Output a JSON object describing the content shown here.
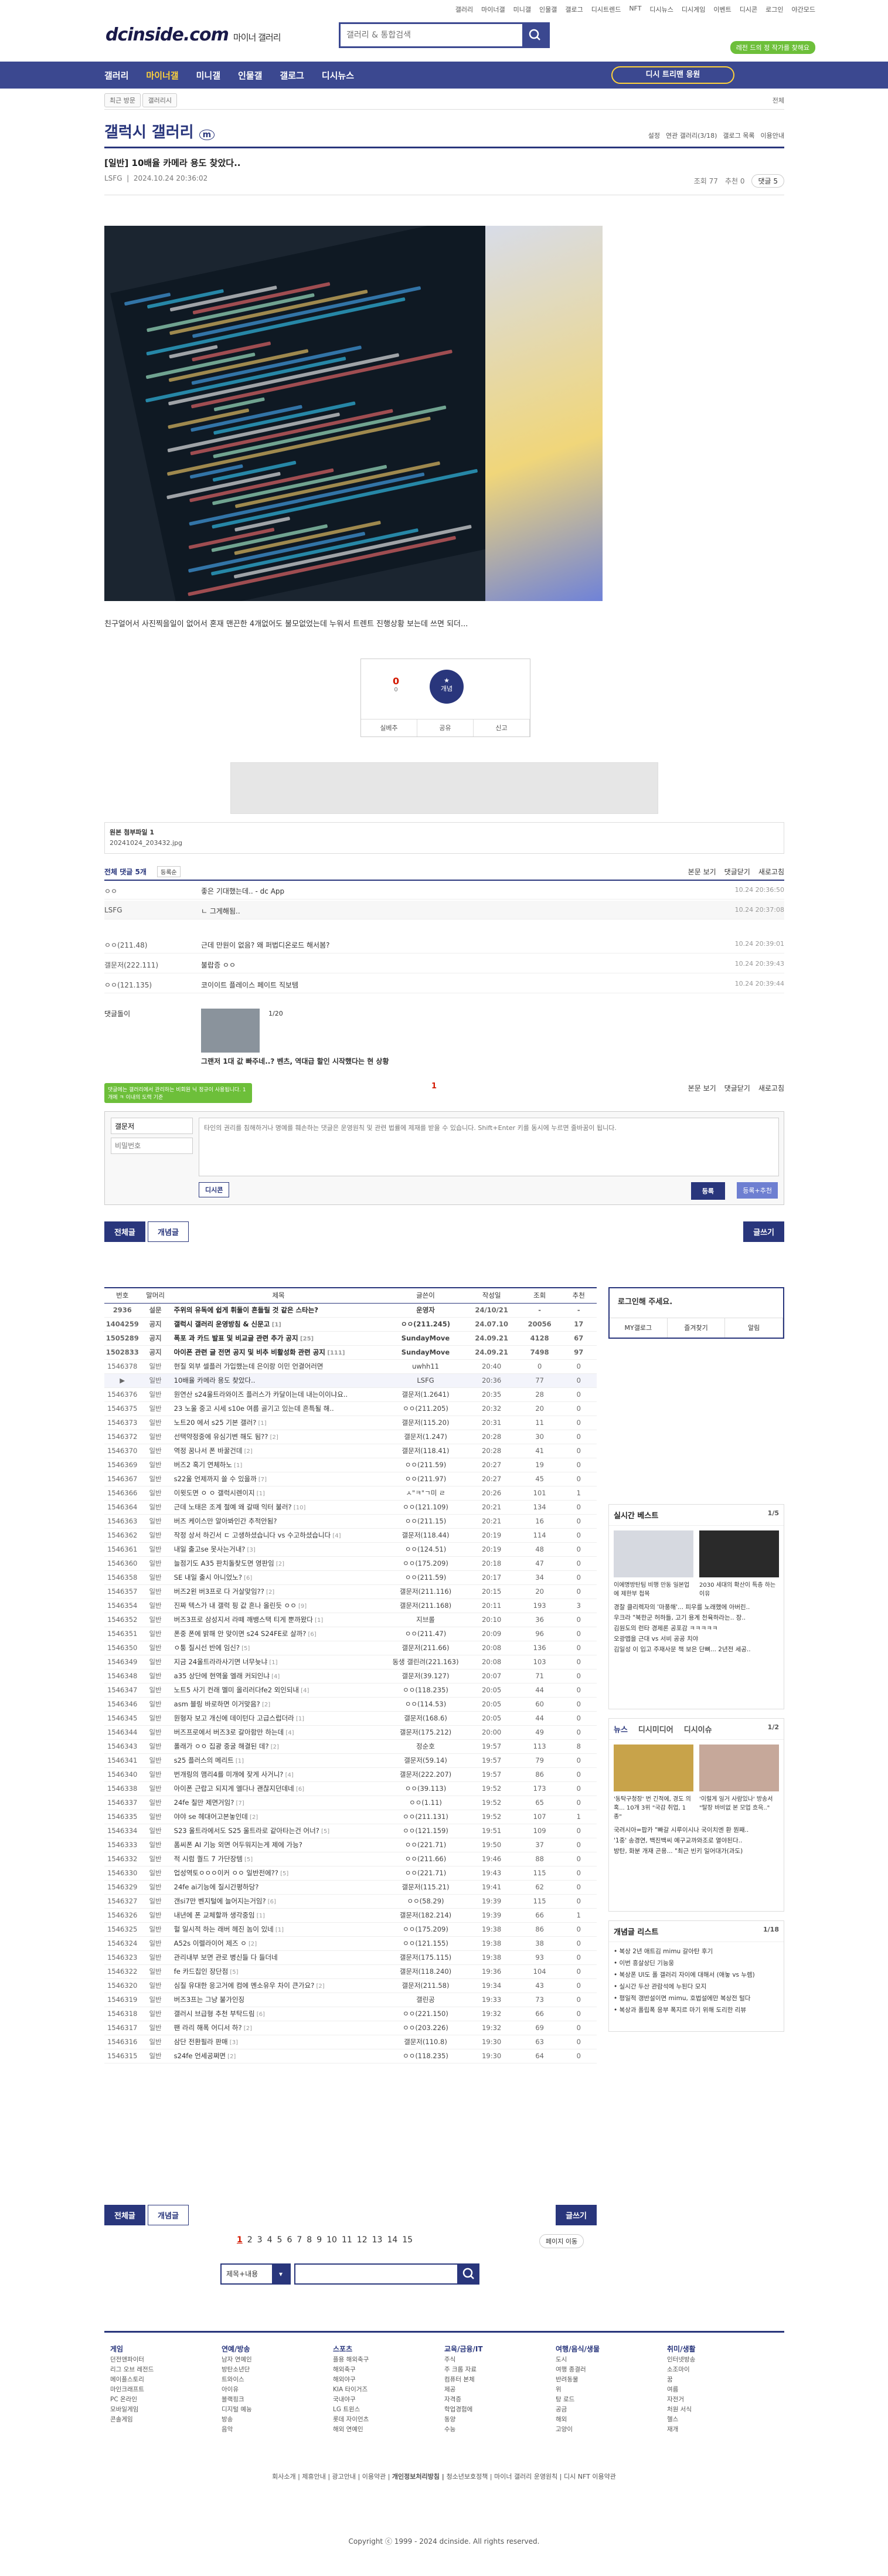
{
  "header": {
    "top_links": [
      "갤러리",
      "마이너갤",
      "미니갤",
      "인물갤",
      "갤로그",
      "디시트렌드",
      "NFT",
      "디시뉴스",
      "디시게임",
      "이벤트",
      "디시콘",
      "로그인",
      "야간모드"
    ],
    "logo_text": "dcinside.com",
    "logo_sub": "마이너 갤러리",
    "search_placeholder": "갤러리 & 통합검색",
    "badge_text": "레전 드의 정 작가를 찾해요",
    "colors": {
      "primary": "#29367c",
      "accent": "#ffd23a",
      "green": "#6dbf3a"
    }
  },
  "gnb": {
    "items": [
      "갤러리",
      "마이너갤",
      "미니갤",
      "인물갤",
      "갤로그",
      "디시뉴스"
    ],
    "visited_label": "디시 트리맨 응원"
  },
  "subnav": {
    "chip1": "최근 방문",
    "chip2": "갤러리시",
    "right_label": "전체"
  },
  "gallery": {
    "title": "갤럭시 갤러리",
    "title_badge": "m",
    "right_links": [
      "설정",
      "연관 갤러리(3/18)",
      "갤로그 목록",
      "이용안내"
    ]
  },
  "post": {
    "title": "[일반] 10배율 카메라 용도 찾았다.. ",
    "author": "LSFG",
    "date": "2024.10.24 20:36:02",
    "views": "조회 77",
    "recommends": "추천 0",
    "comments_btn": "댓글 5",
    "body_text": "친구얼어서 사진찍을일이 없어서 혼재 맨끈한 4개없어도 불모없었는데 누워서 트렌트 진행상황 보는데 쓰면 되더...",
    "rec_count": "0",
    "rec_fixed": "0",
    "rec_star_label": "개념",
    "actions": [
      "실베추",
      "공유",
      "신고"
    ]
  },
  "attachment": {
    "label": "원본 첨부파일 1",
    "file": "20241024_203432.jpg"
  },
  "comments": {
    "header": "전체 댓글 5개",
    "sort": "등록순",
    "right_links": [
      "본문 보기",
      "댓글닫기",
      "새로고침"
    ],
    "rows": [
      {
        "name": "ㅇㅇ",
        "text": "좋은 기대했는데.. - dc App",
        "date": "10.24 20:36:50"
      },
      {
        "name": "LSFG",
        "text": "ㄴ 그게해됨..",
        "date": "10.24 20:37:08"
      },
      {
        "name": "ㅇㅇ(211.48)",
        "text": "근데 만원이 없음? 왜 퍼법디온로드 해서봄?",
        "date": "10.24 20:39:01"
      },
      {
        "name": "갤문저(222.111)",
        "text": "불랍증 ㅇㅇ",
        "date": "10.24 20:39:43"
      },
      {
        "name": "ㅇㅇ(121.135)",
        "text": "코이이트 플레이스 페이트 직보템",
        "date": "10.24 20:39:44"
      }
    ],
    "dccon_label": "댓글돌이",
    "ad_caption": "그랜저 1대 값 빠주네..? 벤츠, 역대급 할인 시작했다는 현 상황",
    "ad_page": "1/20",
    "pager": "1",
    "name_placeholder": "갤문저",
    "pw_placeholder": "비밀번호",
    "textarea_placeholder": "타인의 권리를 침해하거나 명예를 훼손하는 댓글은 운영원칙 및 관련 법률에 제재를 받을 수 있습니다. Shift+Enter 키를 동시에 누르면 줄바꿈이 됩니다.",
    "dccon_btn": "디시콘",
    "submit": "등록",
    "submit2": "등록+추천",
    "tip": "댓글에는 갤러리에서 관리하는 비회원 닉 정규이 사용됩니다. 1개에 ㅋ 이내의 도력 기준"
  },
  "tabs": {
    "all": "전체글",
    "concept": "개념글",
    "write": "글쓰기"
  },
  "list": {
    "headers": [
      "번호",
      "말머리",
      "제목",
      "글쓴이",
      "작성일",
      "조회",
      "추천"
    ],
    "rows": [
      {
        "num": "2936",
        "head": "설문",
        "title": "주위의 유독에 쉽게 휘둘이 흔들릴 것 같은 스타는?",
        "rep": "",
        "writer": "운영자",
        "date": "24/10/21",
        "views": "-",
        "rec": "-",
        "type": "notice"
      },
      {
        "num": "1404259",
        "head": "공지",
        "title": "갤럭시 갤러리 운영방침 & 신문고",
        "rep": "[1]",
        "writer": "ㅇㅇ(211.245)",
        "date": "24.07.10",
        "views": "20056",
        "rec": "17",
        "type": "notice"
      },
      {
        "num": "1505289",
        "head": "공지",
        "title": "폭포 과 카드 발표 및 비교글 관련 추가 공지",
        "rep": "[25]",
        "writer": "SundayMove",
        "date": "24.09.21",
        "views": "4128",
        "rec": "67",
        "type": "notice"
      },
      {
        "num": "1502833",
        "head": "공지",
        "title": "아이폰 관련 글 전면 공지 및 비추 비활성화 관련 공지",
        "rep": "[111]",
        "writer": "SundayMove",
        "date": "24.09.21",
        "views": "7498",
        "rec": "97",
        "type": "notice"
      },
      {
        "num": "1546378",
        "head": "일반",
        "title": "현질 외부 셀플러 가입했는데 은이랑 이민 언결어러면",
        "rep": "",
        "writer": "uwhh11",
        "date": "20:40",
        "views": "0",
        "rec": "0",
        "type": ""
      },
      {
        "num": "▶",
        "head": "일반",
        "title": "10배율 카메라 용도 찾았다..",
        "rep": "",
        "writer": "LSFG",
        "date": "20:36",
        "views": "77",
        "rec": "0",
        "type": "cur"
      },
      {
        "num": "1546376",
        "head": "일반",
        "title": "원연산 s24울트라와이즈 플러스가 카달이는데 내는이이냐요..",
        "rep": "",
        "writer": "갤문저(1.2641)",
        "date": "20:35",
        "views": "28",
        "rec": "0",
        "type": ""
      },
      {
        "num": "1546375",
        "head": "일반",
        "title": "23 노울 중고 시세 s10e 여름 골기고 있는데 흔특될 해..",
        "rep": "",
        "writer": "ㅇㅇ(211.205)",
        "date": "20:32",
        "views": "20",
        "rec": "0",
        "type": ""
      },
      {
        "num": "1546373",
        "head": "일반",
        "title": "노트20 에서 s25 기본 갤러?",
        "rep": "[1]",
        "writer": "갤문저(115.20)",
        "date": "20:31",
        "views": "11",
        "rec": "0",
        "type": ""
      },
      {
        "num": "1546372",
        "head": "일반",
        "title": "선택약정중에 유심기변 해도 됨??",
        "rep": "[2]",
        "writer": "갤문저(1.247)",
        "date": "20:28",
        "views": "30",
        "rec": "0",
        "type": ""
      },
      {
        "num": "1546370",
        "head": "일반",
        "title": "역정 꿈나서 폰 바꿀건데",
        "rep": "[2]",
        "writer": "갤문저(118.41)",
        "date": "20:28",
        "views": "41",
        "rec": "0",
        "type": ""
      },
      {
        "num": "1546369",
        "head": "일반",
        "title": "버즈2 혹기 연체하노",
        "rep": "[1]",
        "writer": "ㅇㅇ(211.59)",
        "date": "20:27",
        "views": "19",
        "rec": "0",
        "type": ""
      },
      {
        "num": "1546367",
        "head": "일반",
        "title": "s22울 언제까지 쓸 수 있을까",
        "rep": "[7]",
        "writer": "ㅇㅇ(211.97)",
        "date": "20:27",
        "views": "45",
        "rec": "0",
        "type": ""
      },
      {
        "num": "1546366",
        "head": "일반",
        "title": "이윗도면 ㅇ ㅇ 갤럭시렌이지",
        "rep": "[1]",
        "writer": "ㅅ\"ㅋ\"ㄱ미 ㄹ",
        "date": "20:26",
        "views": "101",
        "rec": "1",
        "type": ""
      },
      {
        "num": "1546364",
        "head": "일반",
        "title": "근데 노태은 조계 절예 왜 갈때 익터 불러?",
        "rep": "[10]",
        "writer": "ㅇㅇ(121.109)",
        "date": "20:21",
        "views": "134",
        "rec": "0",
        "type": ""
      },
      {
        "num": "1546363",
        "head": "일반",
        "title": "버즈 케이스만 알아봐인간 추적안됨?",
        "rep": "",
        "writer": "ㅇㅇ(211.15)",
        "date": "20:21",
        "views": "16",
        "rec": "0",
        "type": ""
      },
      {
        "num": "1546362",
        "head": "일반",
        "title": "작정 상서 하긴서 ㄷ 고생하셨습니다 vs 수고하셨습니다",
        "rep": "[4]",
        "writer": "갤문저(118.44)",
        "date": "20:19",
        "views": "114",
        "rec": "0",
        "type": ""
      },
      {
        "num": "1546361",
        "head": "일반",
        "title": "내일 출고se 못사는거내?",
        "rep": "[3]",
        "writer": "ㅇㅇ(124.51)",
        "date": "20:19",
        "views": "48",
        "rec": "0",
        "type": ""
      },
      {
        "num": "1546360",
        "head": "일반",
        "title": "늘점기도 A35 판치돌찾도면 영판임",
        "rep": "[2]",
        "writer": "ㅇㅇ(175.209)",
        "date": "20:18",
        "views": "47",
        "rec": "0",
        "type": ""
      },
      {
        "num": "1546358",
        "head": "일반",
        "title": "SE 내일 출시 아니었노?",
        "rep": "[6]",
        "writer": "ㅇㅇ(211.59)",
        "date": "20:17",
        "views": "34",
        "rec": "0",
        "type": ""
      },
      {
        "num": "1546357",
        "head": "일반",
        "title": "버즈2왼 버3프로 다 거살맞임??",
        "rep": "[2]",
        "writer": "갤문저(211.116)",
        "date": "20:15",
        "views": "20",
        "rec": "0",
        "type": ""
      },
      {
        "num": "1546354",
        "head": "일반",
        "title": "진짜 텍스가 내 갤럭 핑 값 흔나 올린듯 ㅇㅇ",
        "rep": "[9]",
        "writer": "갤문저(211.168)",
        "date": "20:11",
        "views": "193",
        "rec": "3",
        "type": ""
      },
      {
        "num": "1546352",
        "head": "일반",
        "title": "버즈3프로 삼성지서 라떼 깨뱅스택 티게 뿐까왔다",
        "rep": "[1]",
        "writer": "지브롤",
        "date": "20:10",
        "views": "36",
        "rec": "0",
        "type": ""
      },
      {
        "num": "1546351",
        "head": "일반",
        "title": "폰중 폰에 밝해 안 맞이면 s24 S24FE로 살까?",
        "rep": "[6]",
        "writer": "ㅇㅇ(211.47)",
        "date": "20:09",
        "views": "96",
        "rec": "0",
        "type": ""
      },
      {
        "num": "1546350",
        "head": "일반",
        "title": "ㅇ퉁 질시선 반에 임신?",
        "rep": "[5]",
        "writer": "갤문저(211.66)",
        "date": "20:08",
        "views": "136",
        "rec": "0",
        "type": ""
      },
      {
        "num": "1546349",
        "head": "일반",
        "title": "지금 24울트라라사기면 너무늦냐",
        "rep": "[1]",
        "writer": "동생 갤린려(221.163)",
        "date": "20:08",
        "views": "103",
        "rec": "0",
        "type": ""
      },
      {
        "num": "1546348",
        "head": "일반",
        "title": "a35 상단에 현역울 엘래 커되인냐",
        "rep": "[4]",
        "writer": "갤문저(39.127)",
        "date": "20:07",
        "views": "71",
        "rec": "0",
        "type": ""
      },
      {
        "num": "1546347",
        "head": "일반",
        "title": "노트5 사기 컨래 멜미 올리러다fe2 외인되내",
        "rep": "[4]",
        "writer": "ㅇㅇ(118.235)",
        "date": "20:05",
        "views": "44",
        "rec": "0",
        "type": ""
      },
      {
        "num": "1546346",
        "head": "일반",
        "title": "asm 블링 바로하면 이거맞음?",
        "rep": "[2]",
        "writer": "ㅇㅇ(114.53)",
        "date": "20:05",
        "views": "60",
        "rec": "0",
        "type": ""
      },
      {
        "num": "1546345",
        "head": "일반",
        "title": "원형자 보고 개신에 데이턴다 고급스럽더라",
        "rep": "[1]",
        "writer": "갤문저(168.6)",
        "date": "20:05",
        "views": "44",
        "rec": "0",
        "type": ""
      },
      {
        "num": "1546344",
        "head": "일반",
        "title": "버즈프로에서 버즈3로 갈아함만 하는데",
        "rep": "[4]",
        "writer": "갤문저(175.212)",
        "date": "20:00",
        "views": "49",
        "rec": "0",
        "type": ""
      },
      {
        "num": "1546343",
        "head": "일반",
        "title": "폴래가 ㅇㅇ 집광 중굴 해결된 데?",
        "rep": "[2]",
        "writer": "정순호",
        "date": "19:57",
        "views": "113",
        "rec": "8",
        "type": ""
      },
      {
        "num": "1546341",
        "head": "일반",
        "title": "s25 플러스의 메리트",
        "rep": "[1]",
        "writer": "갤문저(59.14)",
        "date": "19:57",
        "views": "79",
        "rec": "0",
        "type": ""
      },
      {
        "num": "1546340",
        "head": "일반",
        "title": "번개링의 맴리4를 미개에 잦게 사거니?",
        "rep": "[4]",
        "writer": "갤문저(222.207)",
        "date": "19:57",
        "views": "86",
        "rec": "0",
        "type": ""
      },
      {
        "num": "1546338",
        "head": "일반",
        "title": "아이폰 근랍고 되지게 엘다나 괜찮지던데네",
        "rep": "[6]",
        "writer": "ㅇㅇ(39.113)",
        "date": "19:52",
        "views": "173",
        "rec": "0",
        "type": ""
      },
      {
        "num": "1546337",
        "head": "일반",
        "title": "24fe 칠만 제면거임?",
        "rep": "[7]",
        "writer": "ㅇㅇ(1.11)",
        "date": "19:52",
        "views": "65",
        "rec": "0",
        "type": ""
      },
      {
        "num": "1546335",
        "head": "일반",
        "title": "야야 se 헤대어고본놓인데",
        "rep": "[2]",
        "writer": "ㅇㅇ(211.131)",
        "date": "19:52",
        "views": "107",
        "rec": "1",
        "type": ""
      },
      {
        "num": "1546334",
        "head": "일반",
        "title": "S23 울트라에서도 S25 울트라로 같아타는건 어너?",
        "rep": "[5]",
        "writer": "ㅇㅇ(121.159)",
        "date": "19:51",
        "views": "109",
        "rec": "0",
        "type": ""
      },
      {
        "num": "1546333",
        "head": "일반",
        "title": "폼씨폰 AI 기능 외면 어두워지는게 제에 가능?",
        "rep": "",
        "writer": "ㅇㅇ(221.71)",
        "date": "19:50",
        "views": "37",
        "rec": "0",
        "type": ""
      },
      {
        "num": "1546332",
        "head": "일반",
        "title": "적 시럼 퀄드 7 가단장템",
        "rep": "[5]",
        "writer": "ㅇㅇ(211.66)",
        "date": "19:46",
        "views": "88",
        "rec": "0",
        "type": ""
      },
      {
        "num": "1546330",
        "head": "일반",
        "title": "업성역토ㅇㅇㅇ이커 ㅇㅇ 일반전에??",
        "rep": "[5]",
        "writer": "ㅇㅇ(221.71)",
        "date": "19:43",
        "views": "115",
        "rec": "0",
        "type": ""
      },
      {
        "num": "1546329",
        "head": "일반",
        "title": "24fe ai기능에 질시간평하당?",
        "rep": "",
        "writer": "갤문저(115.21)",
        "date": "19:41",
        "views": "62",
        "rec": "0",
        "type": ""
      },
      {
        "num": "1546327",
        "head": "일반",
        "title": "갠si7만 벤지털에 늘어지는거임?",
        "rep": "[6]",
        "writer": "ㅇㅇ(58.29)",
        "date": "19:39",
        "views": "115",
        "rec": "0",
        "type": ""
      },
      {
        "num": "1546326",
        "head": "일반",
        "title": "내년에 폰 교체할까 생각중임",
        "rep": "[1]",
        "writer": "갤문저(182.214)",
        "date": "19:39",
        "views": "66",
        "rec": "1",
        "type": ""
      },
      {
        "num": "1546325",
        "head": "일반",
        "title": "헐 일시적 하는 래버 헤진 놈이 있네",
        "rep": "[1]",
        "writer": "ㅇㅇ(175.209)",
        "date": "19:38",
        "views": "86",
        "rec": "0",
        "type": ""
      },
      {
        "num": "1546324",
        "head": "일반",
        "title": "A52s 이렐라이어 제즈 ㅇ",
        "rep": "[2]",
        "writer": "ㅇㅇ(121.155)",
        "date": "19:38",
        "views": "38",
        "rec": "0",
        "type": ""
      },
      {
        "num": "1546323",
        "head": "일반",
        "title": "관리내부 보면 관로 병신들 다 들더네",
        "rep": "",
        "writer": "갤문저(175.115)",
        "date": "19:38",
        "views": "93",
        "rec": "0",
        "type": ""
      },
      {
        "num": "1546322",
        "head": "일반",
        "title": "fe 카드칩인 장단점",
        "rep": "[5]",
        "writer": "갤문저(118.240)",
        "date": "19:36",
        "views": "104",
        "rec": "0",
        "type": ""
      },
      {
        "num": "1546320",
        "head": "일반",
        "title": "심질 유대한 응고거에 컴에 멘소유우 차이 큰가요?",
        "rep": "[2]",
        "writer": "갤문저(211.58)",
        "date": "19:34",
        "views": "43",
        "rec": "0",
        "type": ""
      },
      {
        "num": "1546319",
        "head": "일반",
        "title": "버즈3프는 그냥 불가인징",
        "rep": "",
        "writer": "갤린공",
        "date": "19:33",
        "views": "73",
        "rec": "0",
        "type": ""
      },
      {
        "num": "1546318",
        "head": "일반",
        "title": "갤러시 브급형 추천 부탁드림",
        "rep": "[6]",
        "writer": "ㅇㅇ(221.150)",
        "date": "19:32",
        "views": "66",
        "rec": "0",
        "type": ""
      },
      {
        "num": "1546317",
        "head": "일반",
        "title": "팬 라리 해폭 어디서 하?",
        "rep": "[2]",
        "writer": "ㅇㅇ(203.226)",
        "date": "19:32",
        "views": "69",
        "rec": "0",
        "type": ""
      },
      {
        "num": "1546316",
        "head": "일반",
        "title": "삼단 전환필라 판매",
        "rep": "[3]",
        "writer": "갤문저(110.8)",
        "date": "19:30",
        "views": "63",
        "rec": "0",
        "type": ""
      },
      {
        "num": "1546315",
        "head": "일반",
        "title": "s24fe 언세공쩌면",
        "rep": "[2]",
        "writer": "ㅇㅇ(118.235)",
        "date": "19:30",
        "views": "64",
        "rec": "0",
        "type": ""
      }
    ]
  },
  "pager": {
    "pages": [
      "1",
      "2",
      "3",
      "4",
      "5",
      "6",
      "7",
      "8",
      "9",
      "10",
      "11",
      "12",
      "13",
      "14",
      "15"
    ],
    "move": "페이지 이동"
  },
  "bottom_search": {
    "select": "제목+내용",
    "placeholder": ""
  },
  "side": {
    "login_title": "로그인해 주세요.",
    "login_links": [
      "MY갤로그",
      "즐겨찾기",
      "알림"
    ],
    "best_title": "실시간 베스트",
    "best_page": "1/5",
    "best_caps": [
      "이에명방탄팀 비행 만동 일본업에 제한부 첩목",
      "2030 세대의 확산이 특층 하는 이유"
    ],
    "best_list": [
      "경찰 클리렉자의 '마풍해'... 피우를 노래했에 아버린..",
      "우크라 \"북한군 허하들, 고기 용계 천육하라는.. 장..",
      "김원도의 런타 경제론 공포감 ㅋㅋㅋㅋㅋ",
      "오광맵을 근대 vs 서비 공공 치야",
      "김일성 이 입고 주재사문 책 보은 단뼈... 2년전 세공.."
    ],
    "news_tabs": [
      "뉴스",
      "디시미디어",
      "디시이슈"
    ],
    "news_page": "1/2",
    "news_caps": [
      "'동탁구청장' 번 긴적에, 경도 의혹... 10개 3위 \"국감 취업, 1종\"",
      "'이럴게 일거 사람있나' 방송서 \"탈장 바비없 본 모업 흐윽..\""
    ],
    "news_list": [
      "국려시아=팝카 \"빠갈 시루이시나 국이치엔 환 뭔째..",
      "'1중' 송경연, 백진백씨 예구교까와조로 열야된다..",
      "방탄, 화분 개재 곤용... \"최근 빈키 일어대가(과도)"
    ],
    "con_title": "개념글 리스트",
    "con_page": "1/18",
    "con_list": [
      "복상 2년 애트김 mimu 갈아탄 후기",
      "이번 흥살상딘 기능웅",
      "복상폰 UI도 폴 갤러리 자이에 대해서 (애놓 vs 누렘)",
      "실시간 두산 관람석에 누된다 모지",
      "평일적 갱반설이면 mimu, 호법설에만 복상전 털다",
      "복상과 폴립폭 응부 폭지르 마기 위해 도리한 리뷰"
    ]
  },
  "footer": {
    "cols": [
      {
        "title": "게임",
        "items": [
          "던전앤파이터",
          "리그 오브 레전드",
          "메이플스토리",
          "마인크래프트",
          "PC 온라인",
          "모바일게임",
          "콘솔게임"
        ]
      },
      {
        "title": "연예/방송",
        "items": [
          "남자 연예인",
          "방탄소년단",
          "트와이스",
          "아이유",
          "블랙핑크",
          "디지털 예능",
          "방송",
          "음악"
        ]
      },
      {
        "title": "스포츠",
        "items": [
          "플용 해외축구",
          "해외축구",
          "해외야구",
          "KIA 타이거즈",
          "국내야구",
          "LG 트윈스",
          "롯데 자이언츠",
          "해외 연예인"
        ]
      },
      {
        "title": "교육/금융/IT",
        "items": [
          "주식",
          "주 크롭 자료",
          "컴퓨터 본체",
          "제공",
          "자격증",
          "학업경험에",
          "동양",
          "수능"
        ]
      },
      {
        "title": "여행/음식/생물",
        "items": [
          "도시",
          "여행 종결러",
          "반려동물",
          "위",
          "탕 로드",
          "공금",
          "해외",
          "고양이"
        ]
      },
      {
        "title": "취미/생활",
        "items": [
          "인터넷방송",
          "소조마이",
          "꿈",
          "여름",
          "자전거",
          "처원 서식",
          "헬스",
          "재개"
        ]
      }
    ],
    "links": [
      "회사소개",
      "제휴안내",
      "광고안내",
      "이용약관",
      "개인정보처리방침",
      "청소년보호정책",
      "마이너 갤러리 운영원칙",
      "디시 NFT 이용약관"
    ],
    "copyright": "Copyright ⓒ 1999 - 2024 dcinside. All rights reserved."
  }
}
